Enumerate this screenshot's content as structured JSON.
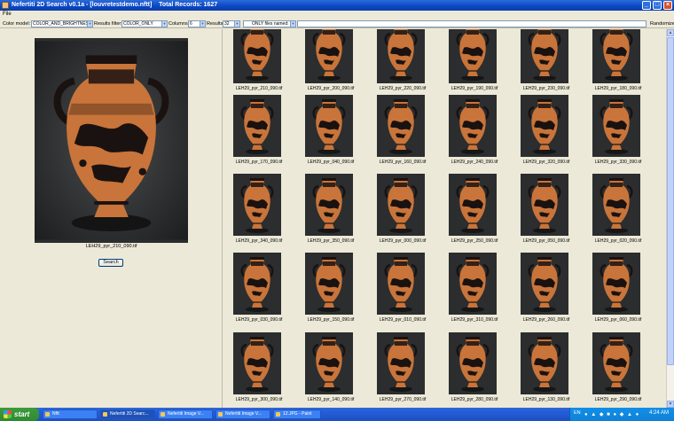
{
  "window": {
    "title": "Nefertiti 2D Search v0.1a - [louvretestdemo.nftt]",
    "total_records": "Total Records: 1627"
  },
  "menu": {
    "file": "File"
  },
  "toolbar": {
    "color_model_label": "Color model:",
    "color_model_value": "COLOR_AND_BRIGHTNESS",
    "results_filter_label": "Results filter:",
    "results_filter_value": "COLOR_ONLY",
    "columns_label": "Columns:",
    "columns_value": "6",
    "results_label": "Results:",
    "results_value": "32",
    "name_filter_value": "ONLY files named:",
    "randomize_label": "Randomize"
  },
  "preview": {
    "caption": "LEH29_pyr_210_090.tif",
    "search_label": "Search"
  },
  "results": {
    "captions": [
      "LEH29_pyr_210_090.tif",
      "LEH29_pyr_200_090.tif",
      "LEH29_pyr_220_090.tif",
      "LEH29_pyr_190_090.tif",
      "LEH29_pyr_230_090.tif",
      "LEH29_pyr_180_090.tif",
      "LEH29_pyr_170_090.tif",
      "LEH29_pyr_040_090.tif",
      "LEH29_pyr_160_090.tif",
      "LEH29_pyr_240_090.tif",
      "LEH29_pyr_320_090.tif",
      "LEH29_pyr_330_090.tif",
      "LEH29_pyr_340_090.tif",
      "LEH29_pyr_350_090.tif",
      "LEH29_pyr_000_090.tif",
      "LEH29_pyr_250_090.tif",
      "LEH29_pyr_050_090.tif",
      "LEH29_pyr_020_090.tif",
      "LEH29_pyr_030_090.tif",
      "LEH29_pyr_150_090.tif",
      "LEH29_pyr_010_090.tif",
      "LEH29_pyr_310_090.tif",
      "LEH29_pyr_260_090.tif",
      "LEH29_pyr_060_090.tif",
      "LEH29_pyr_300_090.tif",
      "LEH29_pyr_140_090.tif",
      "LEH29_pyr_270_090.tif",
      "LEH29_pyr_280_090.tif",
      "LEH29_pyr_130_090.tif",
      "LEH29_pyr_290_090.tif"
    ]
  },
  "taskbar": {
    "start_label": "start",
    "tasks": [
      "Nftt",
      "Nefertiti 2D Searc...",
      "Nefertiti Image V...",
      "Nefertiti Image V...",
      "12.JPG - Paint"
    ],
    "lang": "EN",
    "clock": "4:24 AM"
  },
  "icons": {
    "window": "java-app-icon",
    "minimize": "minimize-icon",
    "maximize": "maximize-icon",
    "close": "close-icon",
    "start": "windows-logo-icon"
  },
  "colors": {
    "titlebar": "#0a46c4",
    "background": "#ece9d8",
    "vase_body": "#c8743a",
    "photo_bg": "#2b2d2e"
  }
}
